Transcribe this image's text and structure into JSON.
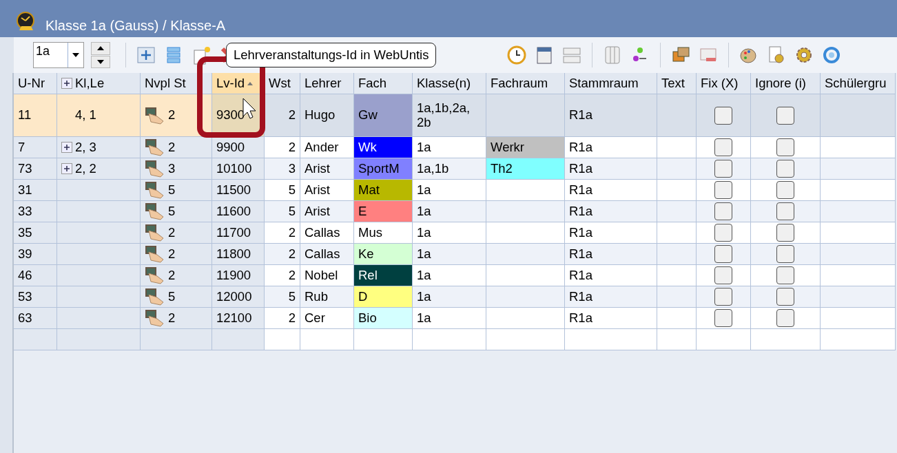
{
  "window": {
    "title": "Klasse 1a (Gauss) / Klasse-A"
  },
  "toolbar": {
    "class_value": "1a"
  },
  "tooltip": {
    "text": "Lehrveranstaltungs-Id in WebUntis"
  },
  "table": {
    "columns": [
      {
        "label": "U-Nr",
        "sorted": false
      },
      {
        "label": "Kl,Le",
        "sorted": false,
        "expanded": false
      },
      {
        "label": "Nvpl St",
        "sorted": false
      },
      {
        "label": "Lv-Id",
        "sorted": true
      },
      {
        "label": "Wst",
        "sorted": false
      },
      {
        "label": "Lehrer",
        "sorted": false
      },
      {
        "label": "Fach",
        "sorted": false
      },
      {
        "label": "Klasse(n)",
        "sorted": false
      },
      {
        "label": "Fachraum",
        "sorted": false
      },
      {
        "label": "Stammraum",
        "sorted": false
      },
      {
        "label": "Text",
        "sorted": false
      },
      {
        "label": "Fix (X)",
        "sorted": false
      },
      {
        "label": "Ignore (i)",
        "sorted": false
      },
      {
        "label": "Schülergru",
        "sorted": false
      }
    ],
    "rows": [
      {
        "selected": true,
        "u_nr": "11",
        "kl_le": "4, 1",
        "nvpl_std": "2",
        "lv_id": "9300",
        "wst": "2",
        "lehrer": "Hugo",
        "fach": {
          "text": "Gw",
          "color": "#9aa0cc"
        },
        "klassen": "1a,1b,2a, 2b",
        "fachraum": null,
        "stammraum": "R1a",
        "fix": false,
        "ignore": false
      },
      {
        "selected": false,
        "u_nr": "7",
        "kl_le": "2, 3",
        "expanded": false,
        "nvpl_std": "2",
        "lv_id": "9900",
        "wst": "2",
        "lehrer": "Ander",
        "fach": {
          "text": "Wk",
          "color": "#0000ff"
        },
        "klassen": "1a",
        "fachraum": {
          "text": "Werkr",
          "color": "#c0c0c0"
        },
        "stammraum": "R1a",
        "fix": false,
        "ignore": false
      },
      {
        "selected": false,
        "u_nr": "73",
        "kl_le": "2, 2",
        "expanded": false,
        "nvpl_std": "3",
        "lv_id": "10100",
        "wst": "3",
        "lehrer": "Arist",
        "fach": {
          "text": "SportM",
          "color": "#8080ff"
        },
        "klassen": "1a,1b",
        "fachraum": {
          "text": "Th2",
          "color": "#80ffff"
        },
        "stammraum": "R1a",
        "fix": false,
        "ignore": false
      },
      {
        "selected": false,
        "u_nr": "31",
        "kl_le": null,
        "nvpl_std": "5",
        "lv_id": "11500",
        "wst": "5",
        "lehrer": "Arist",
        "fach": {
          "text": "Mat",
          "color": "#b8b800"
        },
        "klassen": "1a",
        "fachraum": null,
        "stammraum": "R1a",
        "fix": false,
        "ignore": false
      },
      {
        "selected": false,
        "u_nr": "33",
        "kl_le": null,
        "nvpl_std": "5",
        "lv_id": "11600",
        "wst": "5",
        "lehrer": "Arist",
        "fach": {
          "text": "E",
          "color": "#ff8080"
        },
        "klassen": "1a",
        "fachraum": null,
        "stammraum": "R1a",
        "fix": false,
        "ignore": false
      },
      {
        "selected": false,
        "u_nr": "35",
        "kl_le": null,
        "nvpl_std": "2",
        "lv_id": "11700",
        "wst": "2",
        "lehrer": "Callas",
        "fach": {
          "text": "Mus",
          "color": "#ffffff"
        },
        "klassen": "1a",
        "fachraum": null,
        "stammraum": "R1a",
        "fix": false,
        "ignore": false
      },
      {
        "selected": false,
        "u_nr": "39",
        "kl_le": null,
        "nvpl_std": "2",
        "lv_id": "11800",
        "wst": "2",
        "lehrer": "Callas",
        "fach": {
          "text": "Ke",
          "color": "#d4ffd4"
        },
        "klassen": "1a",
        "fachraum": null,
        "stammraum": "R1a",
        "fix": false,
        "ignore": false
      },
      {
        "selected": false,
        "u_nr": "46",
        "kl_le": null,
        "nvpl_std": "2",
        "lv_id": "11900",
        "wst": "2",
        "lehrer": "Nobel",
        "fach": {
          "text": "Rel",
          "color": "#004040"
        },
        "klassen": "1a",
        "fachraum": null,
        "stammraum": "R1a",
        "fix": false,
        "ignore": false
      },
      {
        "selected": false,
        "u_nr": "53",
        "kl_le": null,
        "nvpl_std": "5",
        "lv_id": "12000",
        "wst": "5",
        "lehrer": "Rub",
        "fach": {
          "text": "D",
          "color": "#ffff80"
        },
        "klassen": "1a",
        "fachraum": null,
        "stammraum": "R1a",
        "fix": false,
        "ignore": false
      },
      {
        "selected": false,
        "u_nr": "63",
        "kl_le": null,
        "nvpl_std": "2",
        "lv_id": "12100",
        "wst": "2",
        "lehrer": "Cer",
        "fach": {
          "text": "Bio",
          "color": "#d4ffff"
        },
        "klassen": "1a",
        "fachraum": null,
        "stammraum": "R1a",
        "fix": false,
        "ignore": false
      }
    ]
  }
}
